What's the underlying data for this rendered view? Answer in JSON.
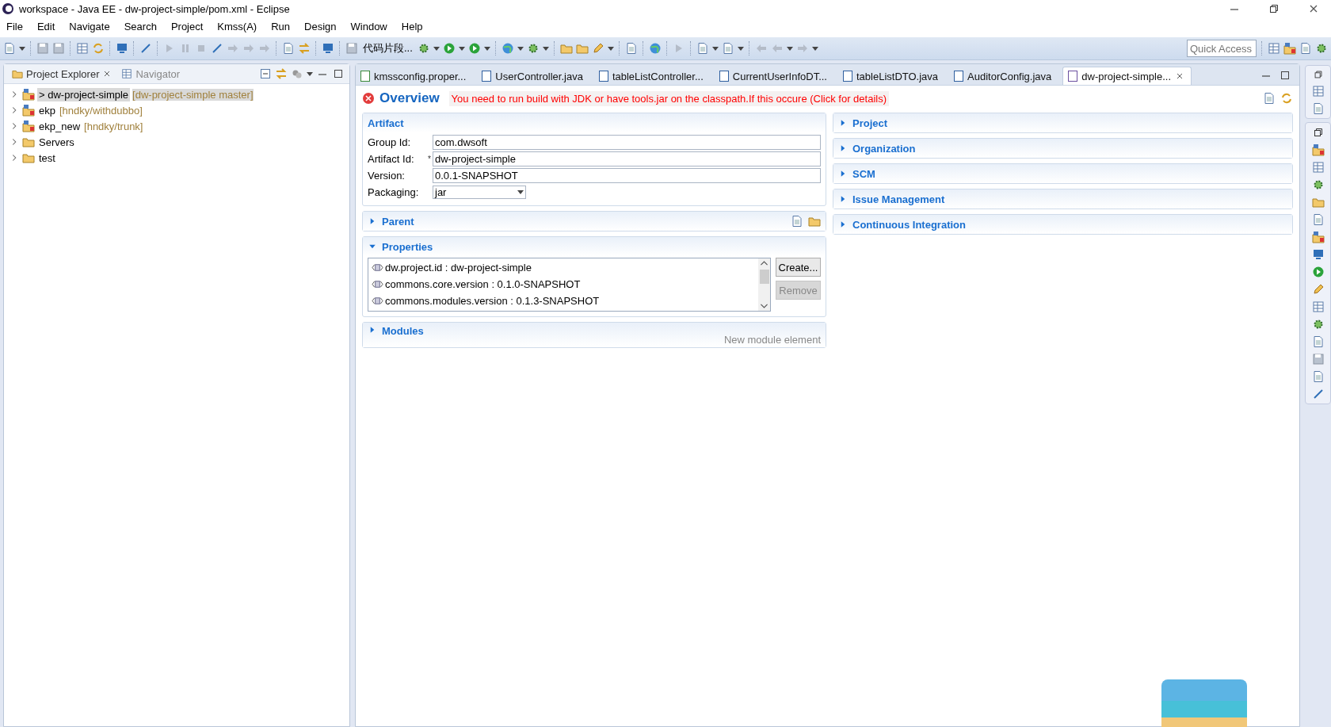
{
  "window": {
    "title": "workspace - Java EE - dw-project-simple/pom.xml - Eclipse"
  },
  "menu": [
    "File",
    "Edit",
    "Navigate",
    "Search",
    "Project",
    "Kmss(A)",
    "Run",
    "Design",
    "Window",
    "Help"
  ],
  "toolbar": {
    "snippets": "代码片段...",
    "quick_access": {
      "placeholder": "Quick Access"
    }
  },
  "explorer": {
    "tabs": [
      {
        "label": "Project Explorer",
        "selected": true
      },
      {
        "label": "Navigator",
        "selected": false
      }
    ],
    "tree": [
      {
        "label": "> dw-project-simple",
        "decoration": "[dw-project-simple master]",
        "kind": "project",
        "selected": true,
        "expanded": false
      },
      {
        "label": "ekp",
        "decoration": "[hndky/withdubbo]",
        "kind": "project",
        "selected": false,
        "expanded": false
      },
      {
        "label": "ekp_new",
        "decoration": "[hndky/trunk]",
        "kind": "project",
        "selected": false,
        "expanded": false
      },
      {
        "label": "Servers",
        "kind": "folder",
        "selected": false,
        "expanded": false
      },
      {
        "label": "test",
        "kind": "folder",
        "selected": false,
        "expanded": false
      }
    ]
  },
  "editor": {
    "tabs": [
      {
        "label": "kmssconfig.proper...",
        "kind": "properties",
        "selected": false
      },
      {
        "label": "UserController.java",
        "kind": "java",
        "selected": false
      },
      {
        "label": "tableListController...",
        "kind": "java",
        "selected": false
      },
      {
        "label": "CurrentUserInfoDT...",
        "kind": "java",
        "selected": false
      },
      {
        "label": "tableListDTO.java",
        "kind": "java",
        "selected": false
      },
      {
        "label": "AuditorConfig.java",
        "kind": "java",
        "selected": false
      },
      {
        "label": "dw-project-simple...",
        "kind": "pom",
        "selected": true
      }
    ],
    "page_title": "Overview",
    "error": "You need to run build with JDK or have tools.jar on the classpath.If this occure (Click for details)",
    "artifact": {
      "title": "Artifact",
      "fields": [
        {
          "label": "Group Id:",
          "value": "com.dwsoft",
          "kind": "text"
        },
        {
          "label": "Artifact Id:",
          "marker": "*",
          "value": "dw-project-simple",
          "kind": "text"
        },
        {
          "label": "Version:",
          "value": "0.0.1-SNAPSHOT",
          "kind": "text"
        },
        {
          "label": "Packaging:",
          "value": "jar",
          "kind": "select"
        }
      ]
    },
    "left_sections": [
      {
        "kind": "parent",
        "title": "Parent",
        "expanded": false
      },
      {
        "kind": "properties",
        "title": "Properties",
        "expanded": true,
        "items": [
          "dw.project.id : dw-project-simple",
          "commons.core.version : 0.1.0-SNAPSHOT",
          "commons.modules.version : 0.1.3-SNAPSHOT"
        ],
        "buttons": [
          {
            "label": "Create...",
            "disabled": false
          },
          {
            "label": "Remove",
            "disabled": true
          }
        ]
      },
      {
        "kind": "modules",
        "title": "Modules",
        "expanded": false,
        "hint": "New module element"
      }
    ],
    "right_sections": [
      {
        "title": "Project",
        "expanded": false
      },
      {
        "title": "Organization",
        "expanded": false
      },
      {
        "title": "SCM",
        "expanded": false
      },
      {
        "title": "Issue Management",
        "expanded": false
      },
      {
        "title": "Continuous Integration",
        "expanded": false
      }
    ]
  }
}
